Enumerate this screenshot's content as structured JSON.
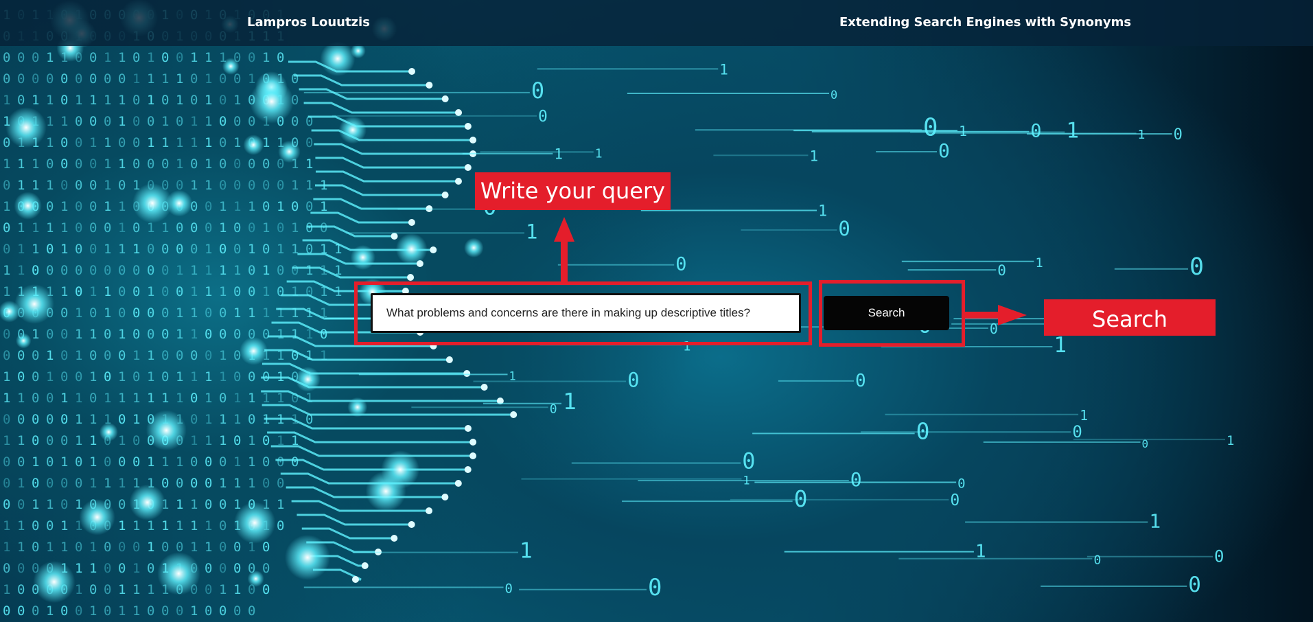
{
  "header": {
    "author": "Lampros Louutzis",
    "title": "Extending Search Engines with Synonyms"
  },
  "search": {
    "query_value": "What problems and concerns are there in making up descriptive titles?",
    "button_label": "Search"
  },
  "annotations": {
    "query_callout": "Write your query",
    "search_callout": "Search"
  },
  "colors": {
    "annotation_red": "#e41e2b",
    "header_bg": "#062238",
    "glow_cyan": "#5ff2ff"
  },
  "background": {
    "description_icons": [
      "binary-digit-icon",
      "circuit-head-icon"
    ]
  }
}
